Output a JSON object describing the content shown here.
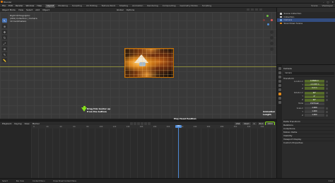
{
  "window": {
    "title": "Blender"
  },
  "menubar": {
    "menus": [
      "File",
      "Edit",
      "Render",
      "Window",
      "Help"
    ],
    "workspaces": [
      "Layout",
      "Modeling",
      "Sculpting",
      "UV Editing",
      "Texture Paint",
      "Shading",
      "Animation",
      "Rendering",
      "Compositing",
      "Geometry Nodes",
      "Scripting"
    ],
    "active_workspace": "Layout",
    "scene_label": "Scene",
    "view_layer_label": "ViewLayer"
  },
  "viewport_header": {
    "items": [
      "Object Mode",
      "View",
      "Select",
      "Add",
      "Object"
    ],
    "mid_items": [
      "Global",
      "Options"
    ]
  },
  "viewport": {
    "view_name": "Right Orthographic",
    "collection_line": "(264) Collection | Camera",
    "unit_line": "10 Centimeters"
  },
  "timeline_header": {
    "items": [
      "Playback",
      "Keying",
      "View",
      "Marker"
    ],
    "current_frame": "264",
    "start_label": "Start",
    "start_value": "1",
    "end_label": "End",
    "end_value": "2860"
  },
  "timeline": {
    "ticks": [
      "0",
      "20",
      "40",
      "60",
      "80",
      "100",
      "120",
      "140",
      "160",
      "180",
      "200",
      "220",
      "240",
      "260",
      "280",
      "300",
      "320",
      "340"
    ],
    "playhead_frame": "264"
  },
  "callouts": {
    "drag_border": "Drag this border up\nfrom the bottom",
    "playhead_position": "Play Head Position",
    "animation_length": "Animation\nLength"
  },
  "outliner": {
    "rows": [
      {
        "label": "Scene Collection",
        "color": "#cfcfcf"
      },
      {
        "label": "Collection",
        "color": "#cfcfcf"
      },
      {
        "label": "Camera",
        "color": "#6fa0d8"
      },
      {
        "label": "Slow Down Scene",
        "color": "#e08a1c"
      }
    ]
  },
  "properties": {
    "object_name": "Camera",
    "data_name": "Camera",
    "section_transform": "Transform",
    "location_label": "Location X",
    "location": [
      "0.3828 m",
      "-1.1138 m",
      "0.0 m"
    ],
    "rotation_label": "Rotation X",
    "rotation": [
      "90°",
      "0°",
      "90°"
    ],
    "mode_label": "Mode",
    "mode_value": "XYZ Euler",
    "scale_label": "Scale X",
    "scale": [
      "1.000",
      "1.000",
      "1.000"
    ],
    "sections": [
      "Delta Transform",
      "Relations",
      "Collections",
      "Motion Paths",
      "Visibility",
      "Viewport Display",
      "Custom Properties"
    ]
  },
  "statusbar": {
    "items": [
      "Select",
      "Pan View",
      "Context Menu",
      "Dope Sheet Context Menu"
    ],
    "version": "3.6.0"
  }
}
